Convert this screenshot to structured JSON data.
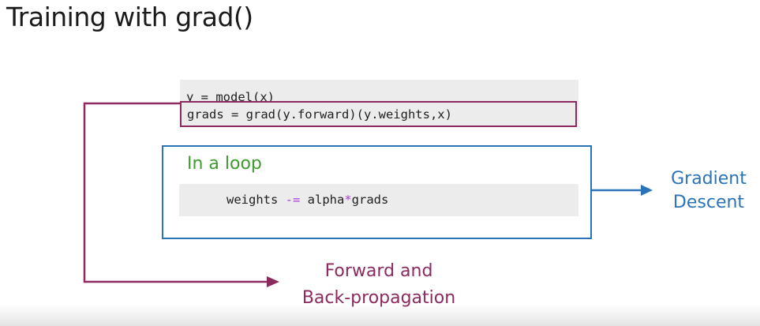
{
  "slide": {
    "title": "Training with grad()"
  },
  "code_top": {
    "line1": "y = model(x)",
    "line2": "grads = grad(y.forward)(y.weights,x)"
  },
  "loop": {
    "label": "In a loop",
    "code_lhs": "weights ",
    "code_op1": "-=",
    "code_mid": " alpha",
    "code_op2": "*",
    "code_rhs": "grads"
  },
  "labels": {
    "gradient_line1": "Gradient",
    "gradient_line2": "Descent",
    "forward_line1": "Forward and",
    "forward_line2": "Back-propagation"
  },
  "colors": {
    "purple": "#8c2a5f",
    "blue": "#2a73b8",
    "green": "#3f9a2f",
    "operator": "#a83ad6"
  }
}
